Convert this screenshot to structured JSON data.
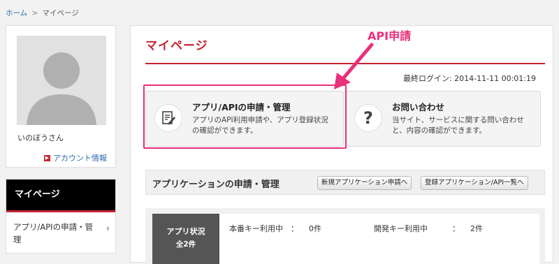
{
  "breadcrumb": {
    "home": "ホーム",
    "separator": ">",
    "current": "マイページ"
  },
  "profile": {
    "username": "いのぼうさん",
    "account_link": "アカウント情報"
  },
  "side_menu": {
    "heading": "マイページ",
    "items": [
      {
        "label": "アプリ/APIの申請・管理"
      }
    ]
  },
  "main": {
    "title": "マイページ",
    "last_login": "最終ログイン: 2014-11-11 00:01:19",
    "tiles": [
      {
        "title": "アプリ/APIの申請・管理",
        "desc": "アプリのAPI利用申請や、アプリ登録状況の確認ができます。",
        "icon": "document-edit-icon"
      },
      {
        "title": "お問い合わせ",
        "desc": "当サイト、サービスに関する問い合わせと、内容の確認ができます。",
        "icon": "question-mark-icon"
      }
    ],
    "section": {
      "title": "アプリケーションの申請・管理",
      "btn_new": "新規アプリケーション申請へ",
      "btn_list": "登録アプリケーション/API一覧へ"
    },
    "status": {
      "label": "アプリ状況",
      "total": "全2件",
      "prod_key_label": "本番キー利用中　：",
      "prod_key_count": "0件",
      "dev_key_label": "開発キー利用中",
      "dev_key_sep": "：",
      "dev_key_count": "2件"
    }
  },
  "annotation": {
    "label": "API申請",
    "color": "#e9307a"
  },
  "colors": {
    "brand_red": "#c4232f",
    "link_blue": "#2a6ab0"
  }
}
